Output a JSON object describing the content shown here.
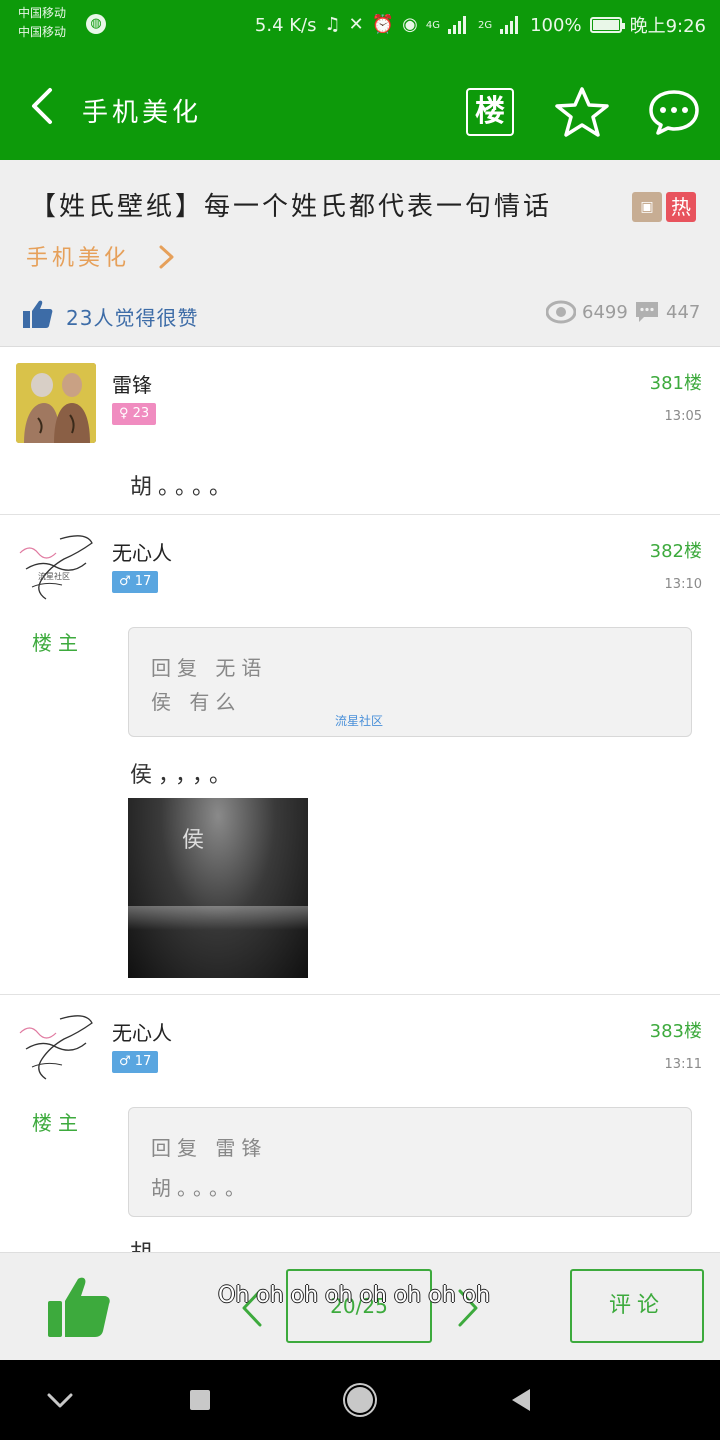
{
  "status_bar": {
    "carrier_1": "中国移动",
    "carrier_2": "中国移动",
    "speed": "5.4 K/s",
    "net_4g": "4G",
    "net_2g": "2G",
    "battery": "100%",
    "time": "晚上9:26"
  },
  "toolbar": {
    "title": "手机美化",
    "floor_label": "楼"
  },
  "post_header": {
    "title": "【姓氏壁纸】每一个姓氏都代表一句情话",
    "tag_hot": "热",
    "forum": "手机美化",
    "likes_text": "23人觉得很赞",
    "views": "6499",
    "comments": "447"
  },
  "posts": [
    {
      "username": "雷锋",
      "badge": "♀ 23",
      "floor": "381楼",
      "time": "13:05",
      "text": "胡。。。。"
    },
    {
      "username": "无心人",
      "badge": "♂ 17",
      "owner_tag": "楼主",
      "floor": "382楼",
      "time": "13:10",
      "quote_line1": "回复 无语",
      "quote_line2": "侯  有么",
      "quote_source": "流星社区",
      "text": "侯，，，。",
      "image_text": "侯"
    },
    {
      "username": "无心人",
      "badge": "♂ 17",
      "owner_tag": "楼主",
      "floor": "383楼",
      "time": "13:11",
      "quote_line1": "回复 雷锋",
      "quote_line2": "胡。。。。",
      "text": "胡"
    }
  ],
  "action_bar": {
    "page": "20/25",
    "overlay": "Oh oh oh oh oh oh oh oh",
    "comment_label": "评论"
  },
  "colors": {
    "primary_green": "#0d9a0a",
    "accent_green": "#3daa3d",
    "hot_red": "#e8535d",
    "forum_orange": "#e6a05a",
    "like_blue": "#3d6ca7"
  }
}
